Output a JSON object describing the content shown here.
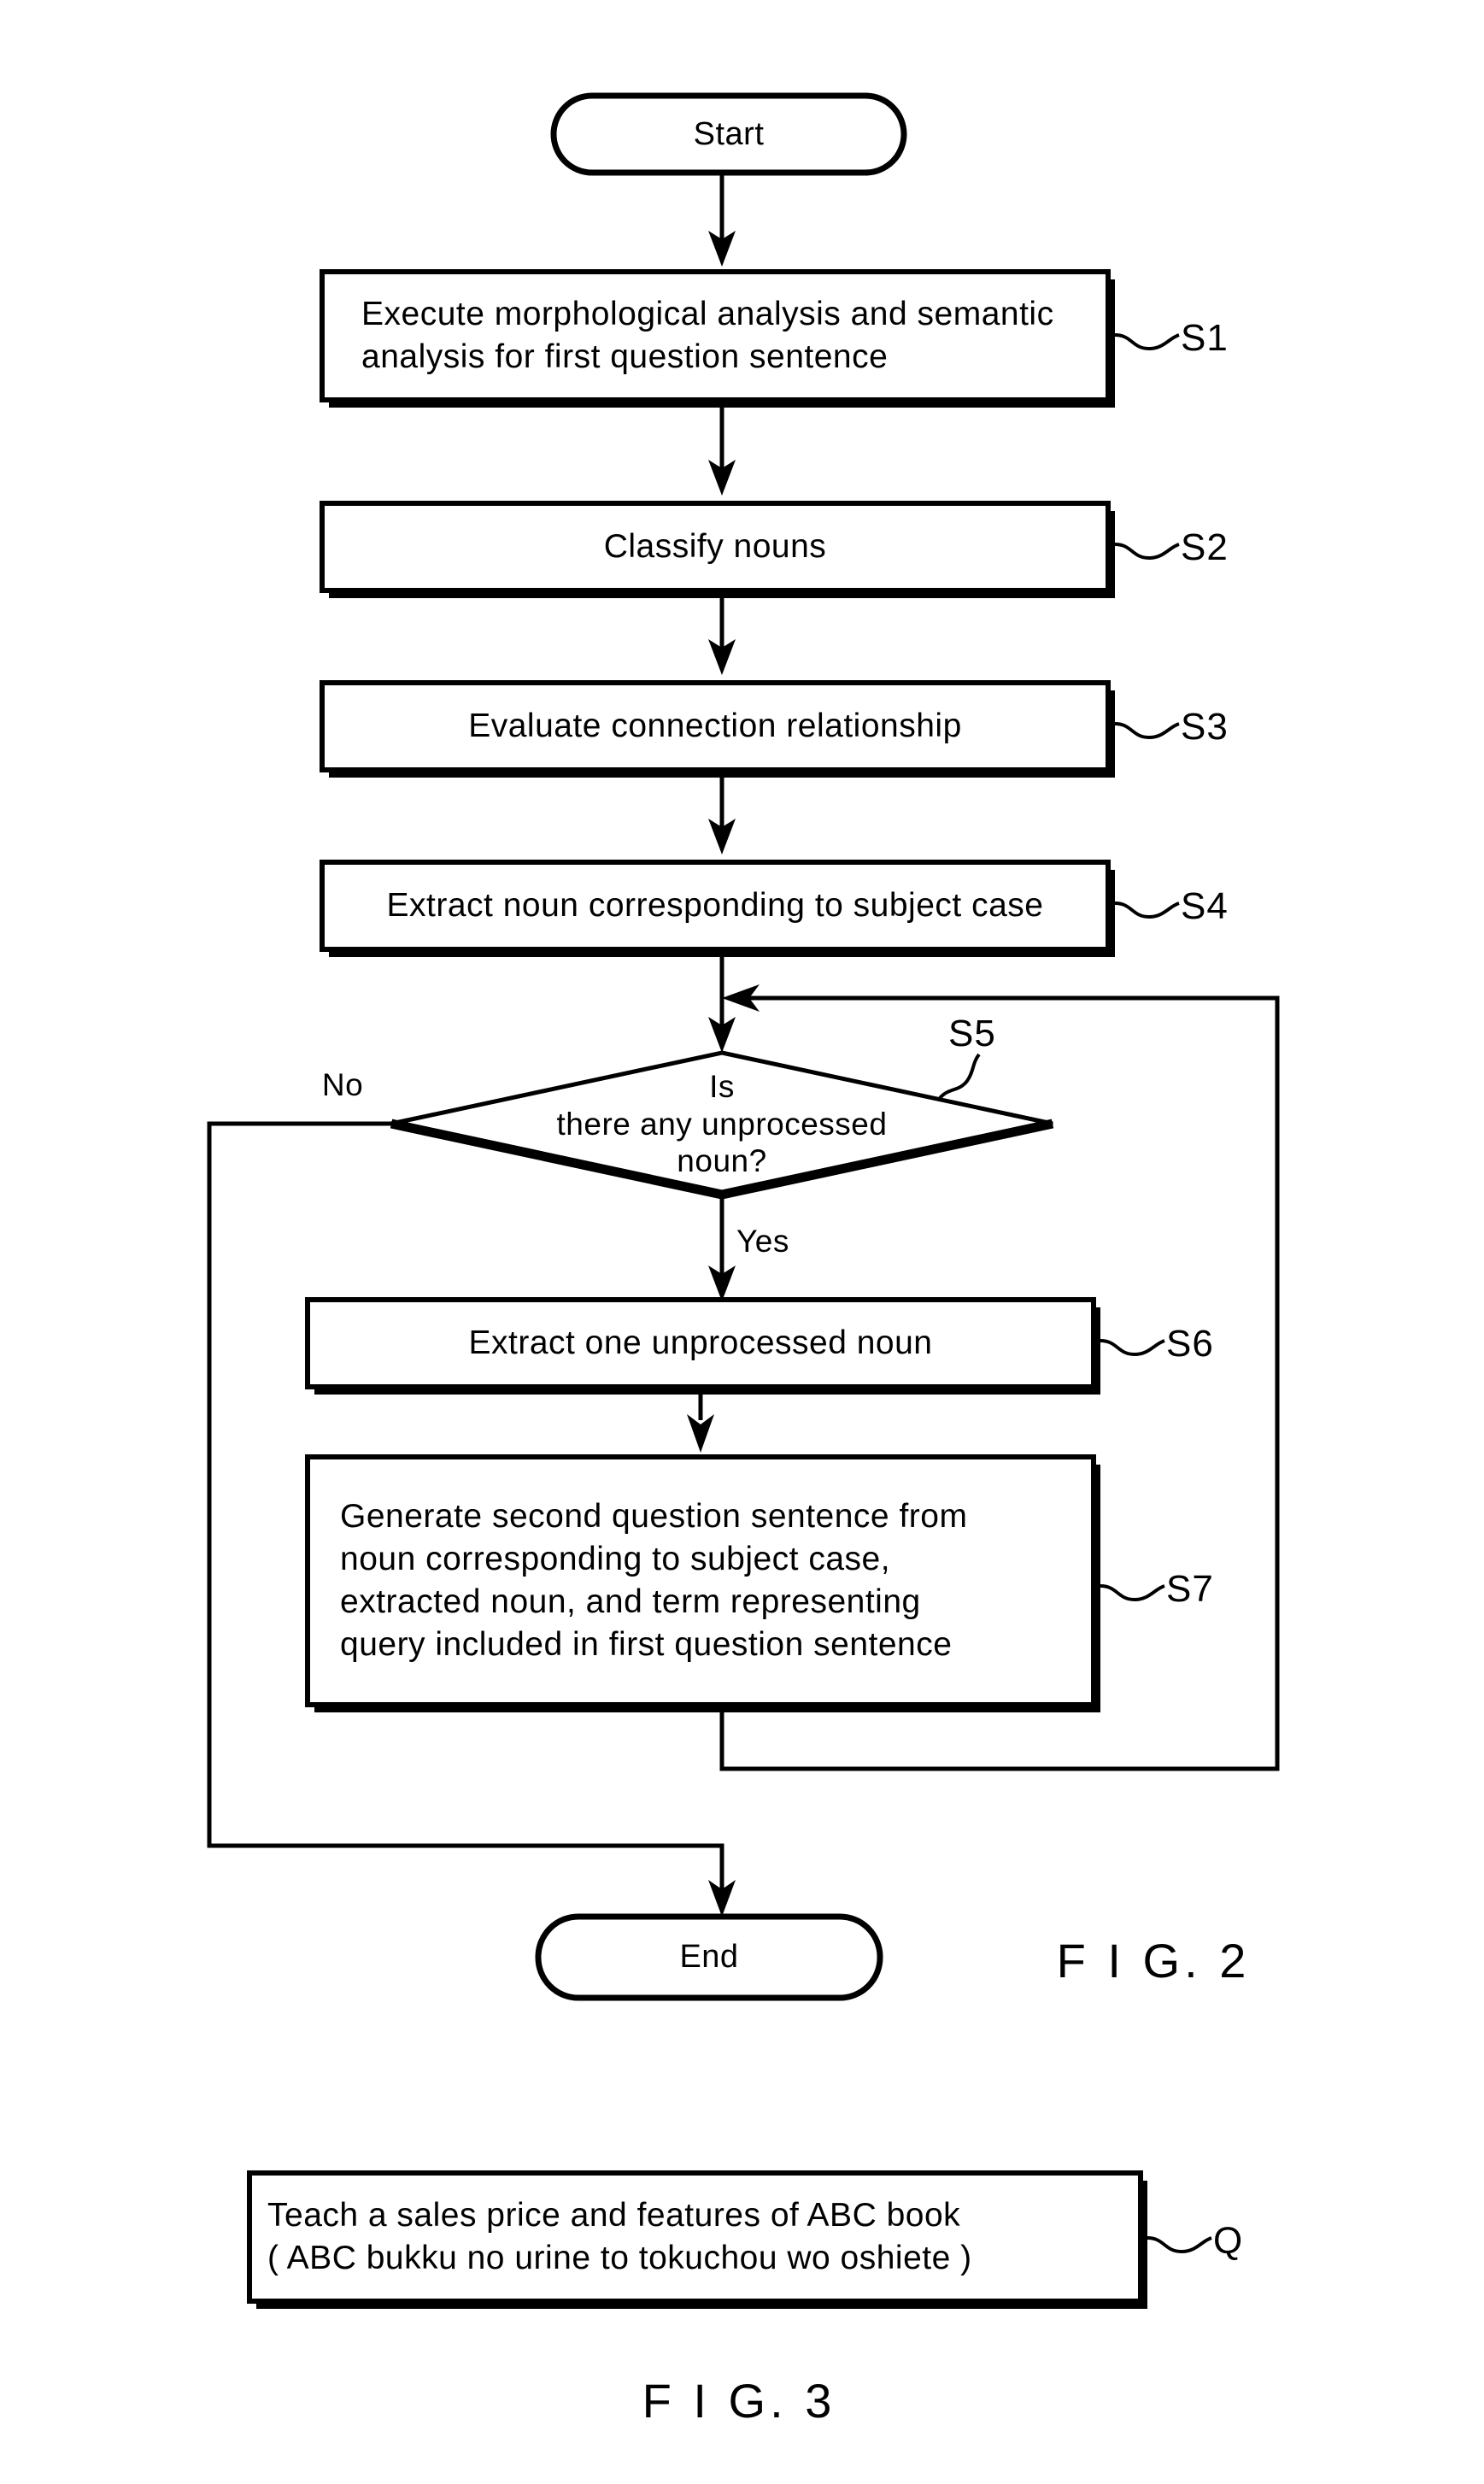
{
  "figure2": {
    "caption": "F I G. 2",
    "start_node": {
      "label": "Start"
    },
    "end_node": {
      "label": "End"
    },
    "steps": [
      {
        "ref": "S1",
        "text": "Execute morphological analysis and semantic\nanalysis for first question sentence"
      },
      {
        "ref": "S2",
        "text": "Classify nouns"
      },
      {
        "ref": "S3",
        "text": "Evaluate connection relationship"
      },
      {
        "ref": "S4",
        "text": "Extract noun corresponding to subject case"
      },
      {
        "ref": "S5",
        "text": "Is\nthere any unprocessed\nnoun?"
      },
      {
        "ref": "S6",
        "text": "Extract one unprocessed noun"
      },
      {
        "ref": "S7",
        "text": "Generate second question sentence from\nnoun corresponding to subject case,\nextracted noun, and term representing\nquery included in first question sentence"
      }
    ],
    "branch_labels": {
      "no": "No",
      "yes": "Yes"
    }
  },
  "figure3": {
    "caption": "F I G. 3",
    "ref": "Q",
    "text": "Teach a sales price and features of ABC book\n( ABC bukku no urine to tokuchou wo oshiete )"
  },
  "colors": {
    "ink": "#000000",
    "paper": "#ffffff"
  }
}
